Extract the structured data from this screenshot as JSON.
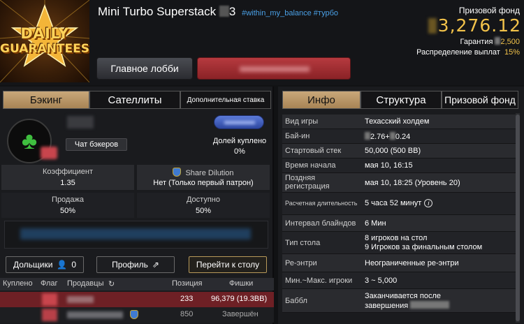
{
  "header": {
    "logo_line1": "DAILY",
    "logo_line2": "GUARANTEES",
    "title": "Mini Turbo Superstack",
    "title_suffix": "3",
    "tags": "#within_my_balance #турбо",
    "lobby_button": "Главное лобби",
    "prize_label": "Призовой фонд",
    "prize_value": "3,276.12",
    "guarantee_label": "Гарантия",
    "guarantee_value": "2,500",
    "distribution_label": "Распределение выплат",
    "distribution_value": "15%"
  },
  "left": {
    "tabs": [
      "Бэкинг",
      "Сателлиты",
      "Дополнительная ставка"
    ],
    "chat_button": "Чат бэкеров",
    "share_label": "Долей куплено",
    "share_value": "0%",
    "stats": {
      "coef_label": "Коэффициент",
      "coef_value": "1.35",
      "dilution_label": "Share Dilution",
      "dilution_value": "Нет (Только первый патрон)",
      "sale_label": "Продажа",
      "sale_value": "50%",
      "available_label": "Доступно",
      "available_value": "50%"
    },
    "buttons": {
      "shareholders": "Дольщики",
      "shareholders_count": "0",
      "profile": "Профиль",
      "goto_table": "Перейти к столу"
    },
    "table": {
      "headers": [
        "Куплено",
        "Флаг",
        "Продавцы",
        "Позиция",
        "Фишки"
      ],
      "rows": [
        {
          "position": "233",
          "chips": "96,379 (19.3BB)"
        },
        {
          "position": "850",
          "chips": "Завершён"
        }
      ]
    }
  },
  "right": {
    "tabs": [
      "Инфо",
      "Структура",
      "Призовой фонд"
    ],
    "rows": [
      {
        "k": "Вид игры",
        "v": "Техасский холдем"
      },
      {
        "k": "Бай-ин",
        "v": "2.76+",
        "v2": "0.24"
      },
      {
        "k": "Стартовый стек",
        "v": "50,000 (500 BB)"
      },
      {
        "k": "Время начала",
        "v": "мая 10, 16:15"
      },
      {
        "k": "Поздняя регистрация",
        "v": "мая 10, 18:25 (Уровень 20)"
      },
      {
        "k": "Расчетная длительность",
        "v": "5 часа 52 минут"
      },
      {
        "k": "Интервал блайндов",
        "v": "6 Мин"
      },
      {
        "k": "Тип стола",
        "v": "8 игроков на стол",
        "v2": "9 Игроков за финальным столом"
      },
      {
        "k": "Ре-энтри",
        "v": "Неограниченные ре-энтри"
      },
      {
        "k": "Мин.~Макс. игроки",
        "v": "3 ~ 5,000"
      },
      {
        "k": "Баббл",
        "v": "Заканчивается после",
        "v2": "завершения"
      }
    ]
  },
  "colors": {
    "accent_gold": "#f2c24a",
    "tab_active": "#b8956a",
    "link_blue": "#4aa0e6",
    "red_button": "#a52e33"
  }
}
